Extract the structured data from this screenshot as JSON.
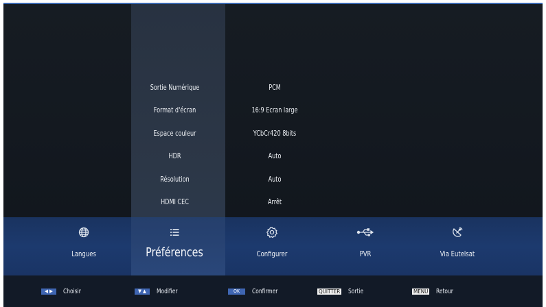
{
  "settings": [
    {
      "label": "Sortie Numérique",
      "value": "PCM"
    },
    {
      "label": "Format d'écran",
      "value": "16:9 Ecran large"
    },
    {
      "label": "Espace couleur",
      "value": "YCbCr420 8bits"
    },
    {
      "label": "HDR",
      "value": "Auto"
    },
    {
      "label": "Résolution",
      "value": "Auto"
    },
    {
      "label": "HDMI CEC",
      "value": "Arrêt"
    }
  ],
  "menu": [
    {
      "label": "Langues",
      "icon": "globe-icon"
    },
    {
      "label": "Préférences",
      "icon": "list-icon",
      "selected": true
    },
    {
      "label": "Configurer",
      "icon": "gear-icon"
    },
    {
      "label": "PVR",
      "icon": "usb-icon"
    },
    {
      "label": "Via Eutelsat",
      "icon": "satellite-dish-icon"
    }
  ],
  "footer": [
    {
      "key": "◀ ▶",
      "label": "Choisir"
    },
    {
      "key": "▼ ▲",
      "label": "Modifier"
    },
    {
      "key": "OK",
      "label": "Confirmer"
    },
    {
      "key": "QUITTER",
      "label": "Sortie"
    },
    {
      "key": "MENU",
      "label": "Retour"
    }
  ],
  "colors": {
    "menu_bar": "#1c3a6e",
    "key_blue": "#3f66b3",
    "selected_column": "#2c3747"
  }
}
